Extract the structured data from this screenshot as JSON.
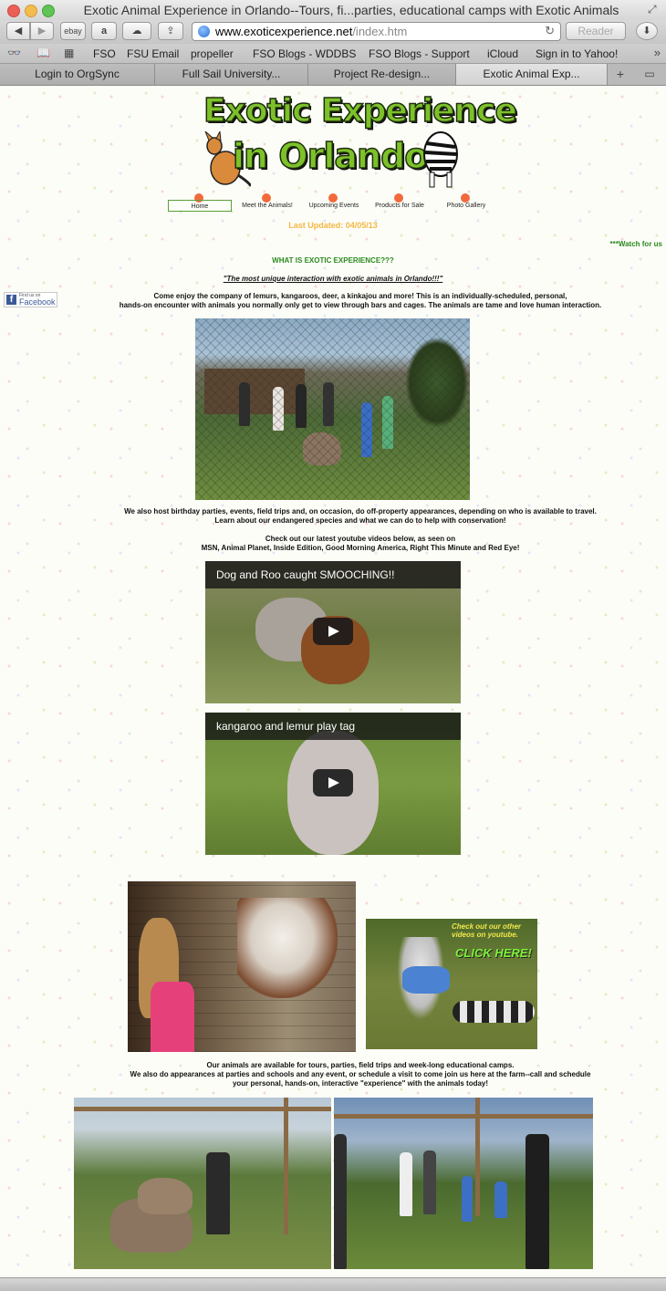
{
  "window": {
    "title": "Exotic Animal Experience in Orlando--Tours, fi...parties, educational camps with Exotic Animals"
  },
  "toolbar": {
    "back_icon": "◀",
    "forward_icon": "▶",
    "ebay_label": "ebay",
    "amazon_label": "a",
    "cloud_icon": "☁",
    "share_icon": "⇪",
    "url_domain": "www.exoticexperience.net",
    "url_path": "/index.htm",
    "reload_icon": "↻",
    "reader_label": "Reader",
    "download_icon": "⬇"
  },
  "bookmarks": {
    "reading_list_icon": "👓",
    "bookmarks_icon": "📖",
    "top_sites_icon": "▦",
    "items": [
      "FSO",
      "FSU Email",
      "propeller",
      "FSO Blogs - WDDBS",
      "FSO Blogs - Support",
      "iCloud",
      "Sign in to Yahoo!"
    ],
    "more_icon": "»"
  },
  "tabs": {
    "items": [
      {
        "label": "Login to OrgSync"
      },
      {
        "label": "Full Sail University..."
      },
      {
        "label": "Project Re-design..."
      },
      {
        "label": "Exotic Animal Exp..."
      }
    ],
    "new_tab_icon": "+",
    "tab_view_icon": "▭"
  },
  "page": {
    "logo_line1": "Exotic Experience",
    "logo_line2": "in Orlando",
    "nav": [
      "Home",
      "Meet the Animals!",
      "Upcoming Events",
      "Products for Sale",
      "Photo Gallery"
    ],
    "last_updated": "Last Updated:  04/05/13",
    "marquee": "***Watch for us",
    "heading": "WHAT IS EXOTIC EXPERIENCE???",
    "tagline": "\"The most unique interaction with exotic animals in Orlando!!!\"",
    "facebook_small": "Find us on",
    "facebook_big": "Facebook",
    "intro_line1": "Come enjoy the company of lemurs, kangaroos, deer, a kinkajou and more!  This is an individually-scheduled, personal,",
    "intro_line2": "hands-on encounter with animals you normally only get to view through bars and cages.  The animals are tame and love human interaction.",
    "events_line1": "We also host birthday parties, events, field trips and, on occasion, do off-property appearances, depending on who is available to travel.",
    "events_line2": "Learn about our endangered species and what we can do to help with conservation!",
    "videos_line1": "Check out our latest youtube videos below, as seen on",
    "videos_line2": "MSN, Animal Planet, Inside Edition, Good Morning America, Right This Minute and Red Eye!",
    "video1_title": "Dog and Roo caught SMOOCHING!!",
    "video2_title": "kangaroo and lemur play tag",
    "promo_line1": "Check out our other",
    "promo_line2": "videos on youtube.",
    "promo_cta": "CLICK HERE!",
    "closing_line1": "Our animals are available for tours, parties, field trips and week-long educational camps.",
    "closing_line2": "We also do appearances at parties and schools and any event, or schedule a visit to come join us here at the farm--call and schedule",
    "closing_line3": "your personal, hands-on, interactive \"experience\" with the animals today!"
  },
  "colors": {
    "accent_green": "#2b8a1e",
    "updated_gold": "#f3b741",
    "nav_dot": "#f26a3b"
  }
}
